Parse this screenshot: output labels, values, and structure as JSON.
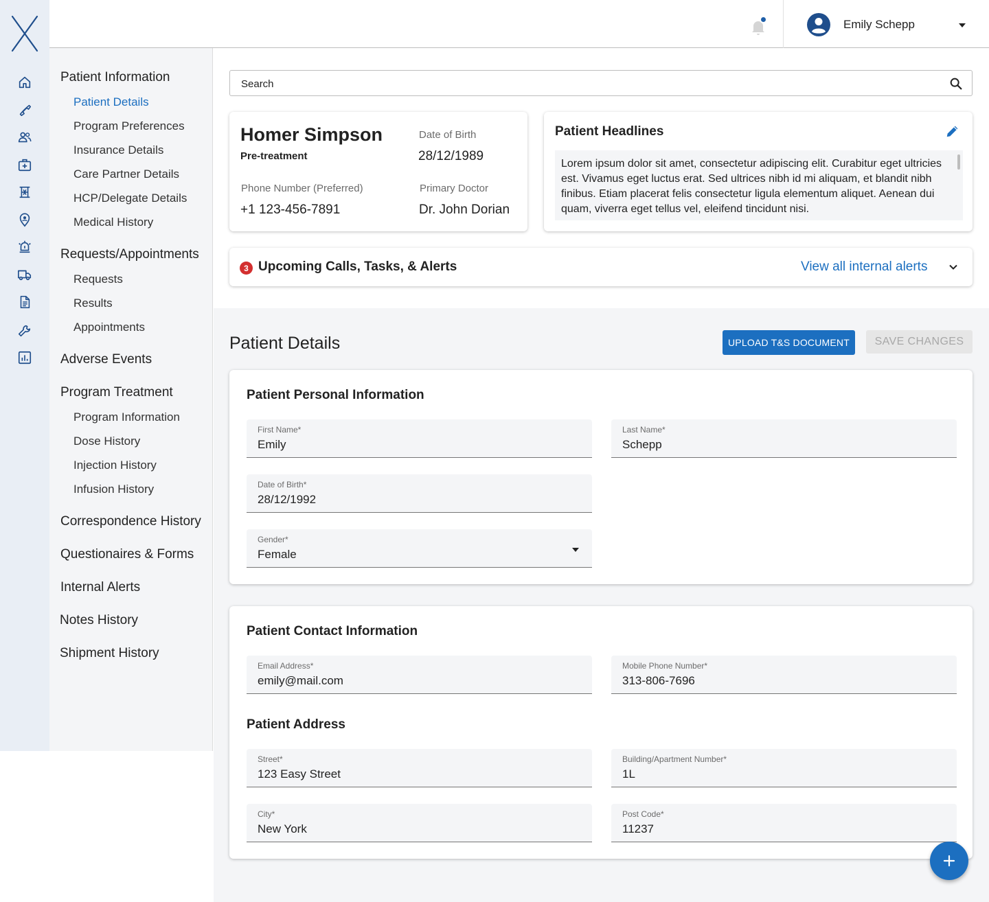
{
  "rail": {
    "icons": [
      "home-icon",
      "phone-icon",
      "people-icon",
      "medical-bag-icon",
      "vaccine-icon",
      "location-icon",
      "alarm-icon",
      "truck-icon",
      "document-icon",
      "wrench-icon",
      "report-icon"
    ]
  },
  "header": {
    "user_name": "Emily Schepp"
  },
  "sidenav": {
    "patient_information": "Patient Information",
    "patient_details": "Patient Details",
    "program_preferences": "Program Preferences",
    "insurance_details": "Insurance Details",
    "care_partner_details": "Care Partner Details",
    "hcp_delegate_details": "HCP/Delegate Details",
    "medical_history": "Medical History",
    "requests_appointments": "Requests/Appointments",
    "requests": "Requests",
    "results": "Results",
    "appointments": "Appointments",
    "adverse_events": "Adverse Events",
    "program_treatment": "Program Treatment",
    "program_information": "Program Information",
    "dose_history": "Dose History",
    "injection_history": "Injection History",
    "infusion_history": "Infusion History",
    "correspondence_history": "Correspondence History",
    "questionaires_forms": "Questionaires & Forms",
    "internal_alerts": "Internal Alerts",
    "notes_history": "Notes History",
    "shipment_history": "Shipment History"
  },
  "search": {
    "text": "Search"
  },
  "patient": {
    "name": "Homer Simpson",
    "status": "Pre-treatment",
    "dob_label": "Date of Birth",
    "dob": "28/12/1989",
    "phone_label": "Phone Number (Preferred)",
    "phone": "+1 123-456-7891",
    "doctor_label": "Primary Doctor",
    "doctor": "Dr. John Dorian"
  },
  "headlines": {
    "title": "Patient Headlines",
    "body": "Lorem ipsum dolor sit amet, consectetur adipiscing elit. Curabitur eget ultricies est. Vivamus eget luctus erat. Sed ultrices nibh id mi aliquam, et blandit nibh finibus. Etiam placerat felis consectetur ligula elementum aliquet. Aenean dui quam, viverra eget tellus vel, eleifend tincidunt nisi."
  },
  "alerts": {
    "count": "3",
    "title": "Upcoming Calls, Tasks, & Alerts",
    "link": "View all internal alerts"
  },
  "details": {
    "title": "Patient Details",
    "upload_button": "UPLOAD T&S DOCUMENT",
    "save_button": "SAVE CHANGES"
  },
  "personal": {
    "heading": "Patient Personal Information",
    "first_name_label": "First Name*",
    "first_name": "Emily",
    "last_name_label": "Last Name*",
    "last_name": "Schepp",
    "dob_label": "Date of Birth*",
    "dob": "28/12/1992",
    "gender_label": "Gender*",
    "gender": "Female"
  },
  "contact": {
    "heading": "Patient Contact Information",
    "email_label": "Email Address*",
    "email": "emily@mail.com",
    "mobile_label": "Mobile Phone Number*",
    "mobile": "313-806-7696"
  },
  "address": {
    "heading": "Patient Address",
    "street_label": "Street*",
    "street": "123 Easy Street",
    "building_label": "Building/Apartment Number*",
    "building": "1L",
    "city_label": "City*",
    "city": "New York",
    "postcode_label": "Post Code*",
    "postcode": "11237"
  },
  "colors": {
    "accent": "#1c6fc0",
    "rail_icon": "#1f4e8c",
    "alert_badge": "#d32f2f",
    "rail_bg": "#e9eef5"
  }
}
